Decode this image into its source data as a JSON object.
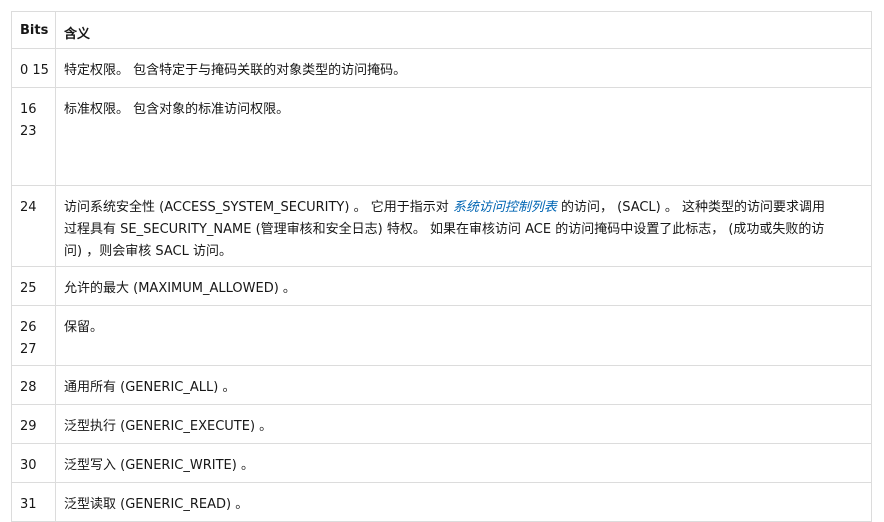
{
  "table": {
    "headers": {
      "bits": "Bits",
      "meaning": "含义"
    },
    "rows": [
      {
        "bits": [
          "0 15"
        ],
        "meaning": "特定权限。 包含特定于与掩码关联的对象类型的访问掩码。"
      },
      {
        "bits": [
          "16",
          "23"
        ],
        "meaning": "标准权限。 包含对象的标准访问权限。"
      },
      {
        "bits": [
          "24"
        ],
        "meaning_before": "访问系统安全性 (ACCESS_SYSTEM_SECURITY) 。 它用于指示对 ",
        "meaning_link": "系统访问控制列表",
        "meaning_after_line1": " 的访问， (SACL) 。 这种类型的访问要求调用",
        "meaning_line2": "过程具有 SE_SECURITY_NAME (管理审核和安全日志) 特权。 如果在审核访问 ACE 的访问掩码中设置了此标志， (成功或失败的访",
        "meaning_line3": "问) ，则会审核 SACL 访问。"
      },
      {
        "bits": [
          "25"
        ],
        "meaning": "允许的最大 (MAXIMUM_ALLOWED) 。"
      },
      {
        "bits": [
          "26",
          "27"
        ],
        "meaning": "保留。"
      },
      {
        "bits": [
          "28"
        ],
        "meaning": "通用所有 (GENERIC_ALL) 。"
      },
      {
        "bits": [
          "29"
        ],
        "meaning": "泛型执行 (GENERIC_EXECUTE) 。"
      },
      {
        "bits": [
          "30"
        ],
        "meaning": "泛型写入 (GENERIC_WRITE) 。"
      },
      {
        "bits": [
          "31"
        ],
        "meaning": "泛型读取 (GENERIC_READ) 。"
      }
    ]
  }
}
